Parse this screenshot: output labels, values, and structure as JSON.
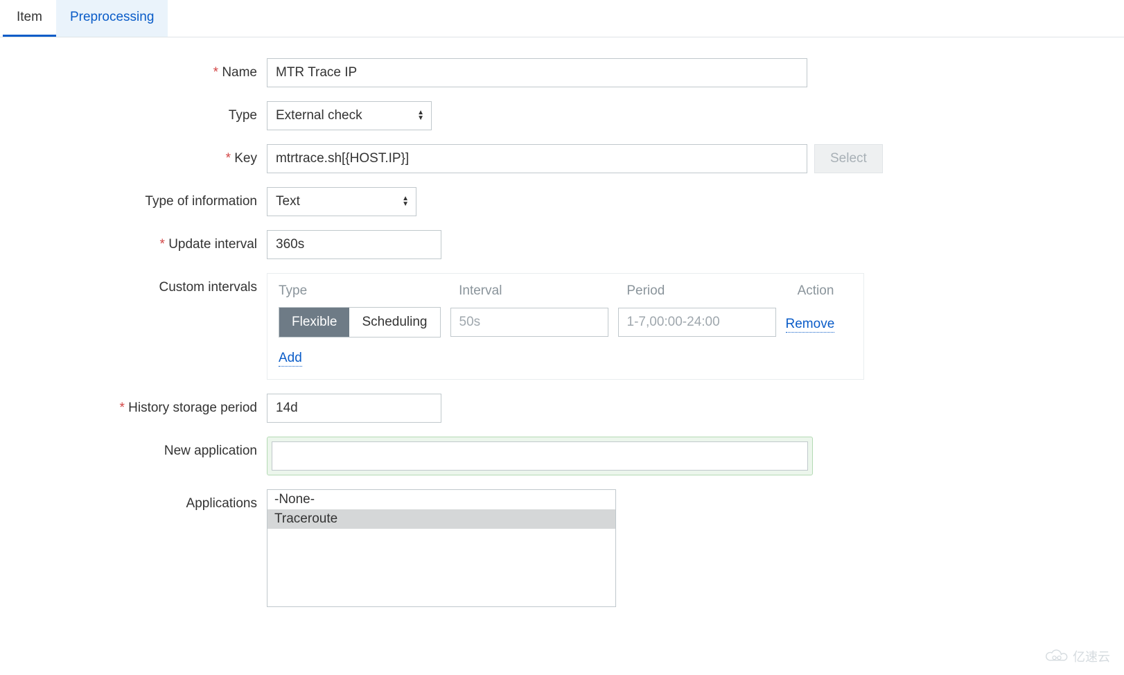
{
  "tabs": {
    "item": "Item",
    "preprocessing": "Preprocessing"
  },
  "labels": {
    "name": "Name",
    "type": "Type",
    "key": "Key",
    "info": "Type of information",
    "update": "Update interval",
    "custom": "Custom intervals",
    "history": "History storage period",
    "newapp": "New application",
    "apps": "Applications"
  },
  "fields": {
    "name": "MTR Trace IP",
    "type": "External check",
    "key": "mtrtrace.sh[{HOST.IP}]",
    "info": "Text",
    "update": "360s",
    "history": "14d",
    "newapp": ""
  },
  "buttons": {
    "select": "Select",
    "add": "Add",
    "remove": "Remove"
  },
  "custom": {
    "headers": {
      "type": "Type",
      "interval": "Interval",
      "period": "Period",
      "action": "Action"
    },
    "toggle": {
      "flexible": "Flexible",
      "scheduling": "Scheduling"
    },
    "placeholders": {
      "interval": "50s",
      "period": "1-7,00:00-24:00"
    }
  },
  "apps": {
    "options": [
      "-None-",
      "Traceroute"
    ],
    "selected": 1
  },
  "watermark": "亿速云"
}
